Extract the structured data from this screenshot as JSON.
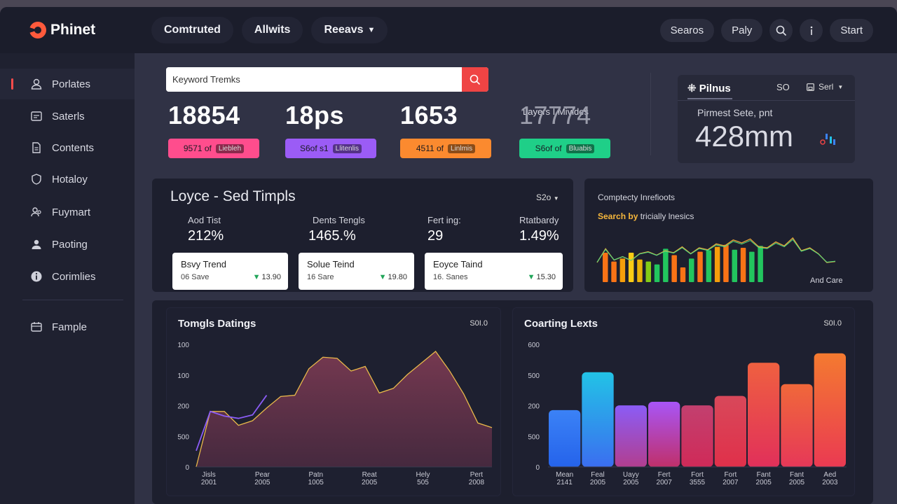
{
  "app": {
    "name": "Phinet"
  },
  "nav": {
    "tabs": [
      "Comtruted",
      "Allwits",
      "Reeavs"
    ]
  },
  "top_actions": {
    "search": "Searos",
    "play": "Paly",
    "start": "Start"
  },
  "sidebar": {
    "items": [
      "Porlates",
      "Saterls",
      "Contents",
      "Hotaloy",
      "Fuymart",
      "Paoting",
      "Corimlies",
      "Fample"
    ]
  },
  "search": {
    "value": "Keyword Tremks"
  },
  "stats": [
    {
      "value": "18854",
      "chip": "9571 of",
      "tag": "Liebleh",
      "color": "#ff4d8d"
    },
    {
      "value": "18ps",
      "chip": "S6of s1",
      "tag": "Llitenlis",
      "color": "#9b5cf6"
    },
    {
      "value": "1653",
      "chip": "4511 of",
      "tag": "Linlmis",
      "color": "#fb8a2f"
    },
    {
      "label": "Layers I Mivides",
      "value": "17774",
      "chip": "S6of of",
      "tag": "Bluabis",
      "color": "#1fcf88"
    }
  ],
  "pilnus": {
    "title": "Pilnus",
    "so": "SO",
    "sort": "Serl",
    "label": "Pirmest Sete, pnt",
    "value": "428mm"
  },
  "loyce": {
    "title": "Loyce - Sed Timpls",
    "dropdown": "S2o",
    "metrics": [
      {
        "label": "Aod Tist",
        "value": "212%"
      },
      {
        "label": "Dents Tengls",
        "value": "1465.%"
      },
      {
        "label": "Fert ing:",
        "value": "29"
      },
      {
        "label": "Rtatbardy",
        "value": "1.49%"
      }
    ],
    "trends": [
      {
        "title": "Bsvy Trend",
        "sub": "06 Save",
        "delta": "13.90"
      },
      {
        "title": "Solue Teind",
        "sub": "16 Sare",
        "delta": "19.80"
      },
      {
        "title": "Eoyce Taind",
        "sub": "16. Sanes",
        "delta": "15.30"
      }
    ]
  },
  "complex": {
    "title": "Comptecty Inrefioots",
    "sub_bold": "Search by",
    "sub_rest": "tricially lnesics",
    "footer": "And Care",
    "bars": [
      {
        "v": 60,
        "c": "#f97316"
      },
      {
        "v": 42,
        "c": "#f97316"
      },
      {
        "v": 48,
        "c": "#f59e0b"
      },
      {
        "v": 60,
        "c": "#facc15"
      },
      {
        "v": 46,
        "c": "#eab308"
      },
      {
        "v": 42,
        "c": "#84cc16"
      },
      {
        "v": 36,
        "c": "#22c55e"
      },
      {
        "v": 68,
        "c": "#22c55e"
      },
      {
        "v": 55,
        "c": "#f97316"
      },
      {
        "v": 30,
        "c": "#f97316"
      },
      {
        "v": 48,
        "c": "#22c55e"
      },
      {
        "v": 62,
        "c": "#f97316"
      },
      {
        "v": 65,
        "c": "#22c55e"
      },
      {
        "v": 72,
        "c": "#f59e0b"
      },
      {
        "v": 76,
        "c": "#f97316"
      },
      {
        "v": 66,
        "c": "#22c55e"
      },
      {
        "v": 70,
        "c": "#f97316"
      },
      {
        "v": 62,
        "c": "#22c55e"
      },
      {
        "v": 74,
        "c": "#22c55e"
      }
    ],
    "line": [
      40,
      68,
      45,
      52,
      44,
      58,
      62,
      55,
      64,
      60,
      72,
      58,
      70,
      66,
      78,
      74,
      86,
      80,
      88,
      72,
      70,
      82,
      74,
      90,
      64,
      70,
      58,
      40,
      42
    ]
  },
  "chart_left": {
    "title": "Tomgls Datings",
    "dropdown": "S0I.0",
    "yticks": [
      "100",
      "100",
      "200",
      "500",
      "0"
    ],
    "xticks": [
      [
        "Jisls",
        "2001"
      ],
      [
        "Pear",
        "2005"
      ],
      [
        "Patn",
        "1005"
      ],
      [
        "Reat",
        "2005"
      ],
      [
        "Hely",
        "505"
      ],
      [
        "Pert",
        "2008"
      ]
    ],
    "area": [
      0,
      48,
      48,
      36,
      40,
      51,
      61,
      62,
      85,
      95,
      94,
      83,
      87,
      64,
      68,
      80,
      90,
      100,
      83,
      63,
      38,
      34
    ],
    "line2": [
      0,
      34,
      30,
      28,
      31,
      48,
      58,
      62,
      82,
      91,
      92,
      80,
      86,
      60,
      68,
      76,
      88,
      96,
      82,
      60,
      30,
      26
    ]
  },
  "chart_right": {
    "title": "Coarting Lexts",
    "dropdown": "S0I.0",
    "yticks": [
      "600",
      "500",
      "200",
      "500",
      "0"
    ],
    "xticks": [
      [
        "Mean",
        "2141"
      ],
      [
        "Feal",
        "2005"
      ],
      [
        "Uayy",
        "2005"
      ],
      [
        "Fert",
        "2007"
      ],
      [
        "Fort",
        "3555"
      ],
      [
        "Fort",
        "2007"
      ],
      [
        "Fant",
        "2005"
      ],
      [
        "Fant",
        "2005"
      ],
      [
        "Aed",
        "2003"
      ]
    ],
    "bars": [
      {
        "v": 48,
        "c1": "#3b82f6",
        "c2": "#2563eb"
      },
      {
        "v": 80,
        "c1": "#22c3e6",
        "c2": "#3b6ef0"
      },
      {
        "v": 52,
        "c1": "#8b5cf6",
        "c2": "#b23e8f"
      },
      {
        "v": 55,
        "c1": "#a855f7",
        "c2": "#c0306a"
      },
      {
        "v": 52,
        "c1": "#c2406f",
        "c2": "#d02a58"
      },
      {
        "v": 60,
        "c1": "#d8485a",
        "c2": "#e0304a"
      },
      {
        "v": 88,
        "c1": "#ef6040",
        "c2": "#e1305a"
      },
      {
        "v": 70,
        "c1": "#f0683a",
        "c2": "#e63858"
      },
      {
        "v": 96,
        "c1": "#f47a30",
        "c2": "#ea3a52"
      }
    ]
  }
}
